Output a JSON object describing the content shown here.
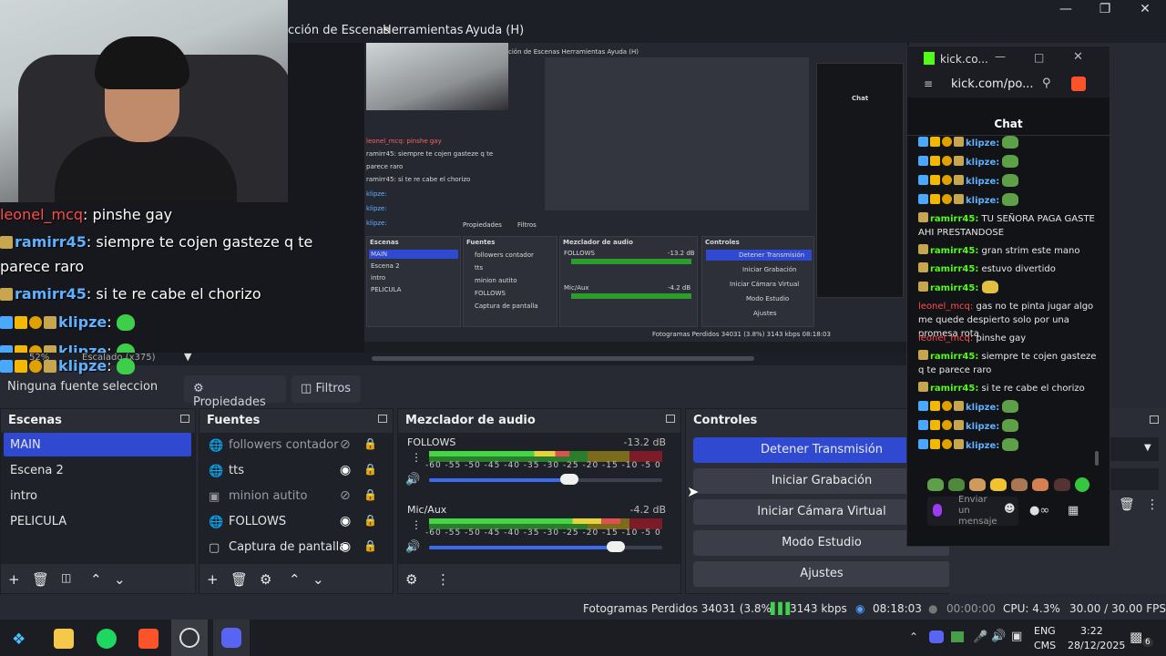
{
  "obs": {
    "menu": [
      "cción de Escenas",
      "Herramientas",
      "Ayuda (H)"
    ],
    "zoom": "52%",
    "canvas_note": "Escalado (x375)",
    "no_source": "Ninguna fuente seleccion",
    "props_tab": "Propiedades",
    "filters_tab": "Filtros"
  },
  "overlay_chat": [
    {
      "user": "leonel_mcq",
      "sep": ":",
      "msg": "pinshe gay",
      "style": "red"
    },
    {
      "user": "ramirr45",
      "sep": ":",
      "msg": "siempre te cojen gasteze q te",
      "style": "blue"
    },
    {
      "cont": "parece raro"
    },
    {
      "user": "ramirr45",
      "sep": ":",
      "msg": "si te re cabe el chorizo",
      "style": "blue"
    },
    {
      "user": "klipze",
      "sep": ":",
      "msg": "",
      "style": "blue"
    },
    {
      "user": "klipze",
      "sep": ":",
      "msg": "",
      "style": "blue"
    },
    {
      "user": "klipze",
      "sep": ":",
      "msg": "",
      "style": "blue"
    }
  ],
  "scenes": {
    "title": "Escenas",
    "items": [
      "MAIN",
      "Escena 2",
      "intro",
      "PELICULA"
    ],
    "active": 0
  },
  "sources": {
    "title": "Fuentes",
    "items": [
      {
        "name": "followers contador",
        "icon": "browser-icon",
        "visible": false
      },
      {
        "name": "tts",
        "icon": "browser-icon",
        "visible": true
      },
      {
        "name": "minion autito",
        "icon": "image-icon",
        "visible": false
      },
      {
        "name": "FOLLOWS",
        "icon": "browser-icon",
        "visible": true
      },
      {
        "name": "Captura de pantalla",
        "icon": "monitor-icon",
        "visible": true
      }
    ]
  },
  "mixer": {
    "title": "Mezclador de audio",
    "ticks": "-60 -55 -50 -45 -40 -35 -30 -25 -20 -15 -10 -5 0",
    "channels": [
      {
        "name": "FOLLOWS",
        "db": "-13.2 dB",
        "level": 0.6,
        "volume": 0.6
      },
      {
        "name": "Mic/Aux",
        "db": "-4.2 dB",
        "level": 0.82,
        "volume": 0.8
      }
    ]
  },
  "controls": {
    "title": "Controles",
    "buttons": [
      "Detener Transmisión",
      "Iniciar Grabación",
      "Iniciar Cámara Virtual",
      "Modo Estudio",
      "Ajustes"
    ]
  },
  "status": {
    "dropped": "Fotogramas Perdidos 34031 (3.8%)",
    "kbps": "3143 kbps",
    "live_time": "08:18:03",
    "rec_time": "00:00:00",
    "cpu": "CPU: 4.3%",
    "fps": "30.00 / 30.00 FPS"
  },
  "taskbar": {
    "lang": "ENG",
    "layout": "CMS",
    "time": "3:22",
    "date": "28/12/2025",
    "notif_count": "6"
  },
  "kick": {
    "tab_title": "kick.co...",
    "url": "kick.com/po...",
    "chat_title": "Chat",
    "input_placeholder": "Enviar un mensaje",
    "messages": [
      {
        "user": "klipze",
        "msg": "",
        "color": "blue"
      },
      {
        "user": "klipze",
        "msg": "",
        "color": "blue"
      },
      {
        "user": "klipze",
        "msg": "",
        "color": "blue"
      },
      {
        "user": "klipze",
        "msg": "",
        "color": "blue"
      },
      {
        "user": "ramirr45",
        "msg": "TU SEÑORA PAGA GASTE AHI PRESTANDOSE",
        "color": "green"
      },
      {
        "user": "ramirr45",
        "msg": "gran strim este mano",
        "color": "green"
      },
      {
        "user": "ramirr45",
        "msg": "estuvo divertido",
        "color": "green"
      },
      {
        "user": "ramirr45",
        "msg": "",
        "color": "green"
      },
      {
        "user": "leonel_mcq",
        "msg": "gas no te pinta jugar algo me quede despierto solo por una promesa rota",
        "color": "red"
      },
      {
        "user": "leonel_mcq",
        "msg": "pinshe gay",
        "color": "red"
      },
      {
        "user": "ramirr45",
        "msg": "siempre te cojen gasteze q te parece raro",
        "color": "green"
      },
      {
        "user": "ramirr45",
        "msg": "si te re cabe el chorizo",
        "color": "green"
      },
      {
        "user": "klipze",
        "msg": "",
        "color": "blue"
      },
      {
        "user": "klipze",
        "msg": "",
        "color": "blue"
      },
      {
        "user": "klipze",
        "msg": "",
        "color": "blue"
      }
    ]
  },
  "nested": {
    "menu": "ción de Escenas   Herramientas   Ayuda (H)",
    "chat": [
      "leonel_mcq: pinshe gay",
      "ramirr45: siempre te cojen gasteze q te",
      "parece raro",
      "ramirr45: si te re cabe el chorizo",
      "klipze:",
      "klipze:",
      "klipze:"
    ],
    "props": "Propiedades",
    "filters": "Filtros",
    "scenes_title": "Escenas",
    "scenes": [
      "MAIN",
      "Escena 2",
      "intro",
      "PELICULA"
    ],
    "sources_title": "Fuentes",
    "sources": [
      "followers contador",
      "tts",
      "minion autito",
      "FOLLOWS",
      "Captura de pantalla"
    ],
    "mixer_title": "Mezclador de audio",
    "mixer_ch": [
      "FOLLOWS",
      "Mic/Aux"
    ],
    "mixer_db": [
      "-13.2 dB",
      "-4.2 dB"
    ],
    "controls_title": "Controles",
    "controls": [
      "Detener Transmisión",
      "Iniciar Grabación",
      "Iniciar Cámara Virtual",
      "Modo Estudio",
      "Ajustes"
    ],
    "status": "Fotogramas Perdidos 34031 (3.8%)   3143 kbps   08:18:03",
    "kick_chat": "Chat"
  }
}
